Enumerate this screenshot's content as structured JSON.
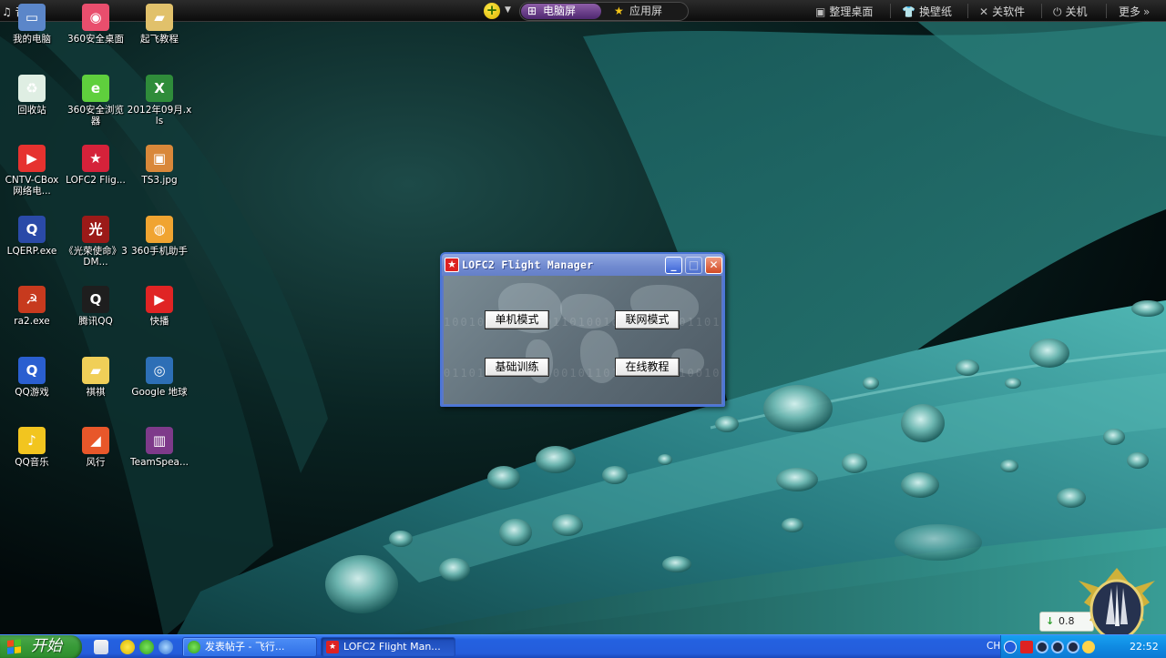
{
  "topbar": {
    "music_label": "音乐",
    "tabs": [
      {
        "label": "电脑屏",
        "icon": "windows-logo-icon",
        "active": true
      },
      {
        "label": "应用屏",
        "icon": "star-icon",
        "active": false
      }
    ],
    "right_items": [
      {
        "label": "整理桌面",
        "icon": "desktop-organize-icon"
      },
      {
        "label": "换壁纸",
        "icon": "shirt-icon"
      },
      {
        "label": "关软件",
        "icon": "close-x-icon"
      },
      {
        "label": "关机",
        "icon": "power-icon"
      },
      {
        "label": "更多",
        "icon": "more-chevron-icon"
      }
    ]
  },
  "desktop_icons": [
    {
      "label": "我的电脑",
      "icon": "computer-icon",
      "color": "#5b86c9"
    },
    {
      "label": "360安全桌面",
      "icon": "360-desktop-icon",
      "color": "#e94e6d"
    },
    {
      "label": "起飞教程",
      "icon": "folder-icon",
      "color": "#e1c16b"
    },
    {
      "label": "回收站",
      "icon": "recycle-bin-icon",
      "color": "#dfeee3"
    },
    {
      "label": "360安全浏览器",
      "icon": "360-browser-icon",
      "color": "#5fcf3d"
    },
    {
      "label": "2012年09月.xls",
      "icon": "excel-file-icon",
      "color": "#2f8c3a"
    },
    {
      "label": "CNTV-CBox 网络电...",
      "icon": "cntv-cbox-icon",
      "color": "#e6322f"
    },
    {
      "label": "LOFC2 Flig...",
      "icon": "lofc2-icon",
      "color": "#d5223a"
    },
    {
      "label": "TS3.jpg",
      "icon": "image-file-icon",
      "color": "#d9883a"
    },
    {
      "label": "LQERP.exe",
      "icon": "lqerp-icon",
      "color": "#2a4aa8"
    },
    {
      "label": "《光荣使命》3DM...",
      "icon": "game-glory-icon",
      "color": "#9b1a18"
    },
    {
      "label": "360手机助手",
      "icon": "360-phone-icon",
      "color": "#f0a431"
    },
    {
      "label": "ra2.exe",
      "icon": "ra2-icon",
      "color": "#c73a1e"
    },
    {
      "label": "腾讯QQ",
      "icon": "qq-penguin-icon",
      "color": "#1e1e1e"
    },
    {
      "label": "快播",
      "icon": "qvod-player-icon",
      "color": "#e02424"
    },
    {
      "label": "QQ游戏",
      "icon": "qq-game-icon",
      "color": "#2a5fd0"
    },
    {
      "label": "祺祺",
      "icon": "folder-icon",
      "color": "#f0cf58"
    },
    {
      "label": "Google 地球",
      "icon": "google-earth-icon",
      "color": "#2d6fb6"
    },
    {
      "label": "QQ音乐",
      "icon": "qq-music-icon",
      "color": "#f2c51f"
    },
    {
      "label": "风行",
      "icon": "funshion-icon",
      "color": "#e8572a"
    },
    {
      "label": "TeamSpea...",
      "icon": "winrar-icon",
      "color": "#7e3a8a"
    }
  ],
  "dialog": {
    "title": "LOFC2 Flight Manager",
    "buttons": {
      "single": "单机模式",
      "network": "联网模式",
      "training": "基础训练",
      "tutorial": "在线教程"
    }
  },
  "taskbar": {
    "start_label": "开始",
    "tasks": [
      {
        "label": "发表帖子 - 飞行...",
        "icon": "360-browser-icon",
        "active": false
      },
      {
        "label": "LOFC2 Flight Man...",
        "icon": "lofc2-icon",
        "active": true
      }
    ],
    "language": "CH",
    "clock": "22:52"
  },
  "speed_widget": {
    "value": "0.8"
  }
}
